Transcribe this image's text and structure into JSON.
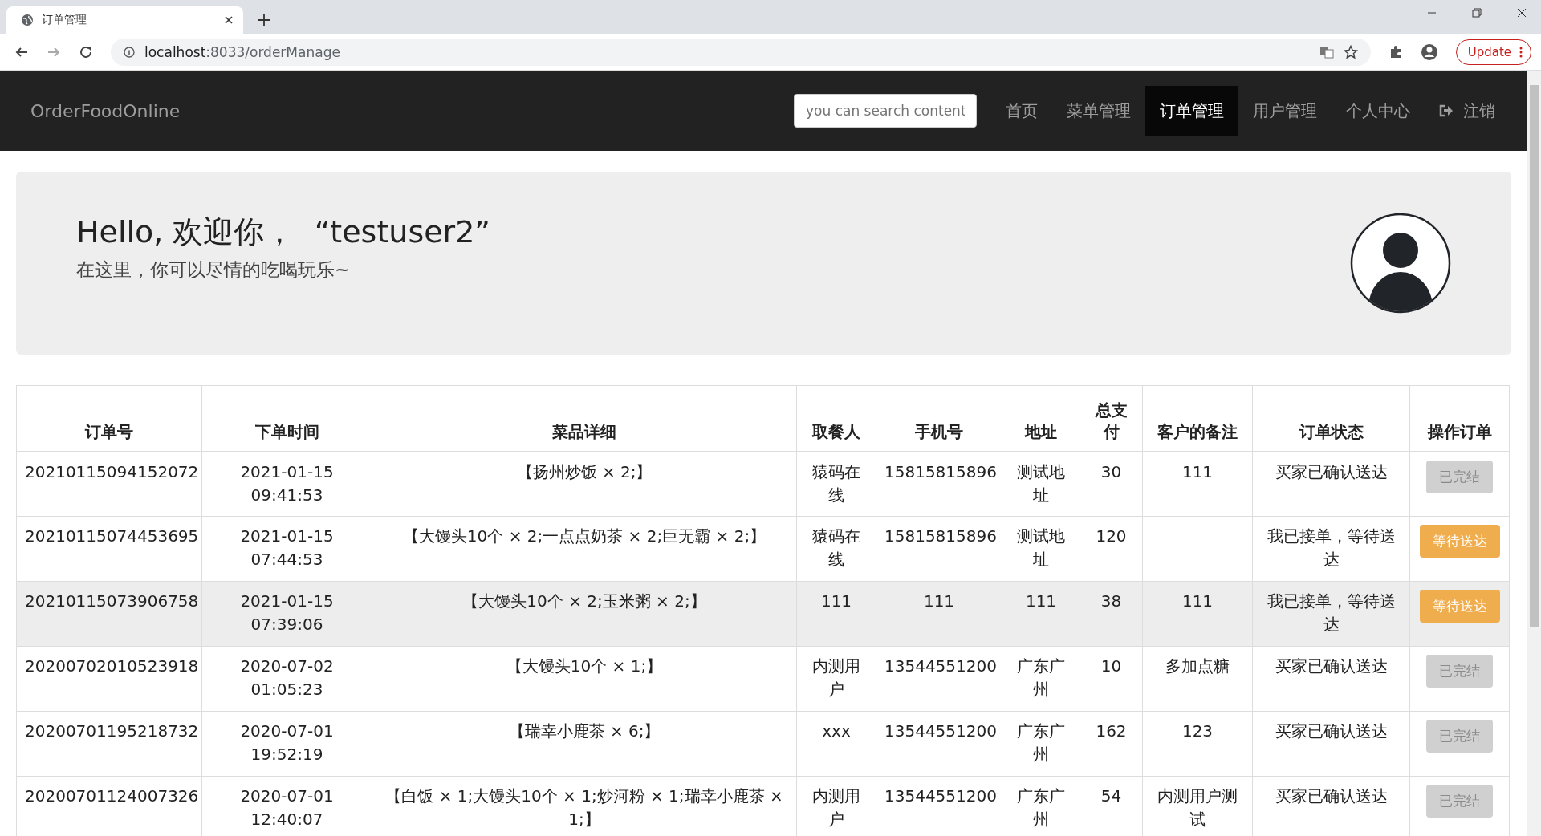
{
  "browser": {
    "tab_title": "订单管理",
    "url_host": "localhost",
    "url_rest": ":8033/orderManage",
    "update_label": "Update"
  },
  "navbar": {
    "brand": "OrderFoodOnline",
    "search": {
      "placeholder": "you can search content"
    },
    "items": [
      {
        "label": "首页",
        "selected": false
      },
      {
        "label": "菜单管理",
        "selected": false
      },
      {
        "label": "订单管理",
        "selected": true
      },
      {
        "label": "用户管理",
        "selected": false
      },
      {
        "label": "个人中心",
        "selected": false
      }
    ],
    "logout": "注销"
  },
  "welcome": {
    "title": "Hello, 欢迎你，  “testuser2”",
    "subtitle": "在这里，你可以尽情的吃喝玩乐~"
  },
  "table": {
    "columns": [
      "订单号",
      "下单时间",
      "菜品详细",
      "取餐人",
      "手机号",
      "地址",
      "总支付",
      "客户的备注",
      "订单状态",
      "操作订单"
    ],
    "rows": [
      {
        "highlighted": false,
        "cells": [
          "20210115094152072",
          "2021-01-15 09:41:53",
          "【扬州炒饭 × 2;】",
          "猿码在线",
          "15815815896",
          "测试地址",
          "30",
          "111",
          "买家已确认送达"
        ],
        "action": {
          "label": "已完结",
          "kind": "done"
        }
      },
      {
        "highlighted": false,
        "cells": [
          "20210115074453695",
          "2021-01-15 07:44:53",
          "【大馒头10个 × 2;一点点奶茶 × 2;巨无霸 × 2;】",
          "猿码在线",
          "15815815896",
          "测试地址",
          "120",
          "",
          "我已接单，等待送达"
        ],
        "action": {
          "label": "等待送达",
          "kind": "waiting"
        }
      },
      {
        "highlighted": true,
        "cells": [
          "20210115073906758",
          "2021-01-15 07:39:06",
          "【大馒头10个 × 2;玉米粥 × 2;】",
          "111",
          "111",
          "111",
          "38",
          "111",
          "我已接单，等待送达"
        ],
        "action": {
          "label": "等待送达",
          "kind": "waiting"
        }
      },
      {
        "highlighted": false,
        "cells": [
          "20200702010523918",
          "2020-07-02 01:05:23",
          "【大馒头10个 × 1;】",
          "内测用户",
          "13544551200",
          "广东广州",
          "10",
          "多加点糖",
          "买家已确认送达"
        ],
        "action": {
          "label": "已完结",
          "kind": "done"
        }
      },
      {
        "highlighted": false,
        "cells": [
          "20200701195218732",
          "2020-07-01 19:52:19",
          "【瑞幸小鹿茶 × 6;】",
          "xxx",
          "13544551200",
          "广东广州",
          "162",
          "123",
          "买家已确认送达"
        ],
        "action": {
          "label": "已完结",
          "kind": "done"
        }
      },
      {
        "highlighted": false,
        "cells": [
          "20200701124007326",
          "2020-07-01 12:40:07",
          "【白饭 × 1;大馒头10个 × 1;炒河粉 × 1;瑞幸小鹿茶 × 1;】",
          "内测用户",
          "13544551200",
          "广东广州",
          "54",
          "内测用户测试",
          "买家已确认送达"
        ],
        "action": {
          "label": "已完结",
          "kind": "done"
        }
      }
    ]
  }
}
